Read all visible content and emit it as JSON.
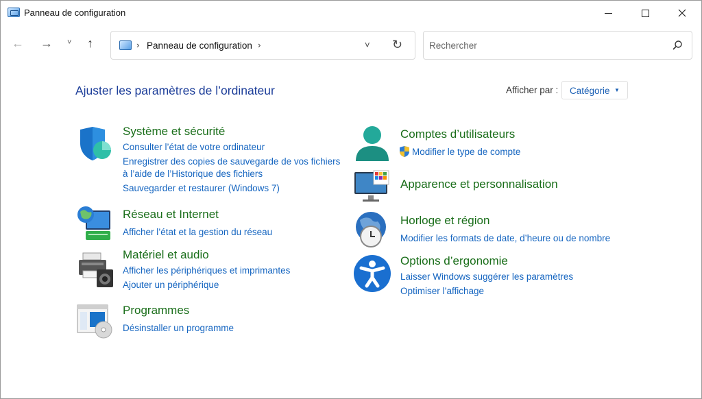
{
  "window": {
    "title": "Panneau de configuration"
  },
  "toolbar": {
    "back": "←",
    "forward": "→",
    "recent": "˅",
    "up": "↑"
  },
  "address": {
    "chevron": "›",
    "path": "Panneau de configuration",
    "dropdown": "˅",
    "refresh": "↻"
  },
  "search": {
    "placeholder": "Rechercher"
  },
  "main": {
    "heading": "Ajuster les paramètres de l’ordinateur",
    "view_label": "Afficher par :",
    "view_value": "Catégorie"
  },
  "categories_left": [
    {
      "title": "Système et sécurité",
      "icon": "shield-icon",
      "links": [
        "Consulter l’état de votre ordinateur",
        "Enregistrer des copies de sauvegarde de vos fichiers",
        "à l’aide de l’Historique des fichiers",
        "Sauvegarder et restaurer (Windows 7)"
      ]
    },
    {
      "title": "Réseau et Internet",
      "icon": "network-globe-icon",
      "links": [
        "Afficher l’état et la gestion du réseau"
      ]
    },
    {
      "title": "Matériel et audio",
      "icon": "printer-speaker-icon",
      "links": [
        "Afficher les périphériques et imprimantes",
        "Ajouter un périphérique"
      ]
    },
    {
      "title": "Programmes",
      "icon": "programs-disc-icon",
      "links": [
        "Désinstaller un programme"
      ]
    }
  ],
  "categories_right": [
    {
      "title": "Comptes d’utilisateurs",
      "icon": "user-accounts-icon",
      "links": [
        "Modifier le type de compte"
      ]
    },
    {
      "title": "Apparence et personnalisation",
      "icon": "monitor-personalize-icon",
      "links": []
    },
    {
      "title": "Horloge et région",
      "icon": "clock-globe-icon",
      "links": [
        "Modifier les formats de date, d’heure ou de nombre"
      ]
    },
    {
      "title": "Options d’ergonomie",
      "icon": "accessibility-icon",
      "links": [
        "Laisser Windows suggérer les paramètres",
        "Optimiser l’affichage"
      ]
    }
  ],
  "colors": {
    "heading": "#1e3f9a",
    "category_title": "#1a6e1a",
    "link": "#1565c0"
  }
}
